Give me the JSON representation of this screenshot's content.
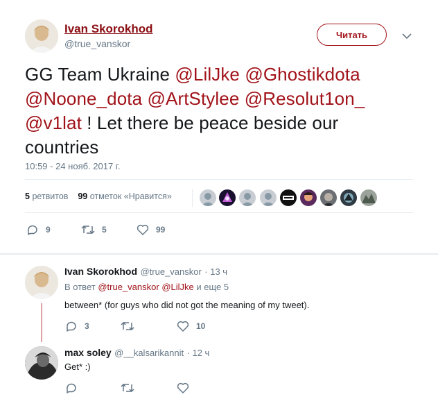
{
  "tweet": {
    "author_name": "Ivan Skorokhod",
    "author_handle": "@true_vanskor",
    "follow_label": "Читать",
    "text_parts": [
      {
        "text": "GG Team Ukraine ",
        "mention": false
      },
      {
        "text": "@LilJke",
        "mention": true
      },
      {
        "text": " ",
        "mention": false
      },
      {
        "text": "@Ghostikdota",
        "mention": true
      },
      {
        "text": " ",
        "mention": false
      },
      {
        "text": "@Noone_dota",
        "mention": true
      },
      {
        "text": " ",
        "mention": false
      },
      {
        "text": "@ArtStylee",
        "mention": true
      },
      {
        "text": " ",
        "mention": false
      },
      {
        "text": "@Resolut1on_",
        "mention": true
      },
      {
        "text": " ",
        "mention": false
      },
      {
        "text": "@v1lat",
        "mention": true
      },
      {
        "text": " ! Let there be peace beside our countries",
        "mention": false
      }
    ],
    "timestamp": "10:59 - 24 нояб. 2017 г.",
    "retweets_count": "5",
    "retweets_label": "ретвитов",
    "likes_count": "99",
    "likes_label": "отметок «Нравится»",
    "actions": {
      "replies": "9",
      "retweets": "5",
      "likes": "99"
    }
  },
  "replies": [
    {
      "name": "Ivan Skorokhod",
      "handle": "@true_vanskor",
      "time": "· 13 ч",
      "reply_prefix": "В ответ",
      "reply_mention1": "@true_vanskor",
      "reply_mention2": "@LilJke",
      "reply_suffix": "и еще 5",
      "text": "between* (for guys who did not got the meaning of my tweet).",
      "actions": {
        "replies": "3",
        "retweets": "",
        "likes": "10"
      }
    },
    {
      "name": "max soley",
      "handle": "@__kalsarikannit",
      "time": "· 12 ч",
      "text": "Get* :)",
      "actions": {
        "replies": "",
        "retweets": "",
        "likes": ""
      }
    }
  ],
  "colors": {
    "accent": "#a1131a",
    "muted": "#657786",
    "text": "#14171a"
  }
}
